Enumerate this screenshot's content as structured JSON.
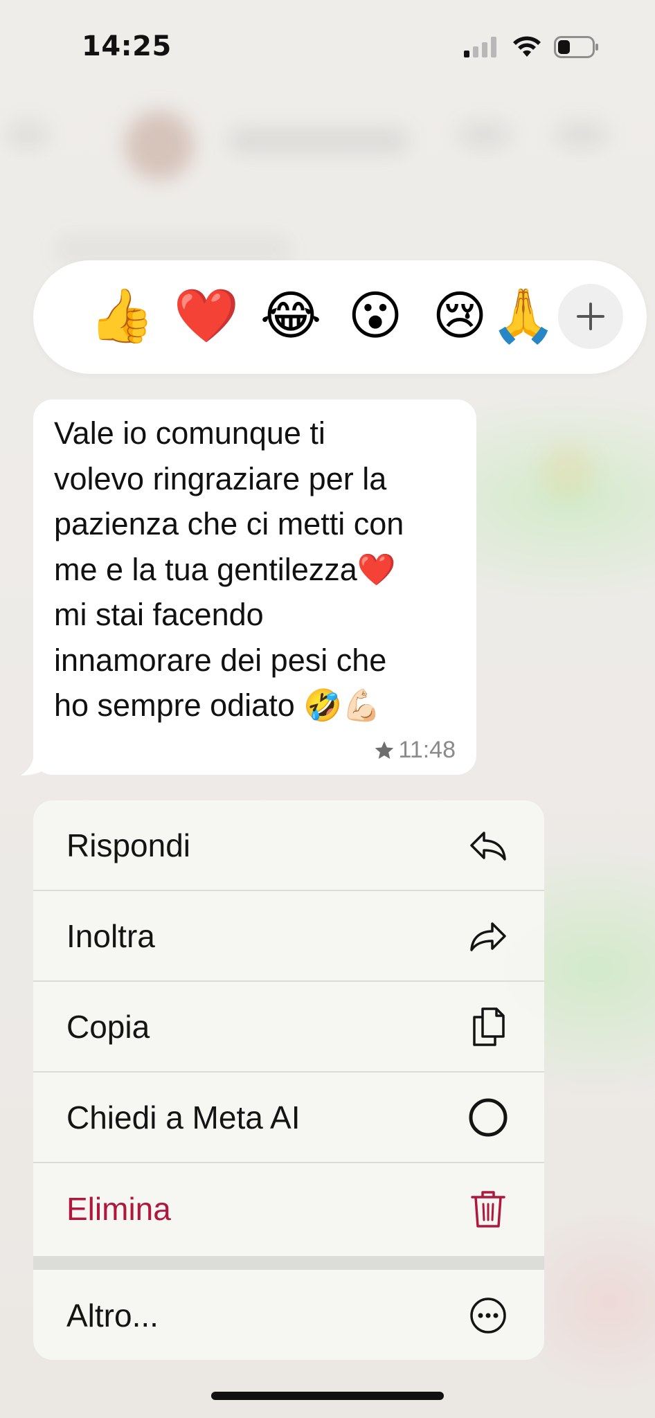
{
  "status_bar": {
    "time": "14:25"
  },
  "reactions": [
    {
      "emoji": "👍",
      "name": "thumbs-up"
    },
    {
      "emoji": "❤️",
      "name": "red-heart"
    },
    {
      "emoji": "😂",
      "name": "tears-of-joy"
    },
    {
      "emoji": "😮",
      "name": "open-mouth"
    },
    {
      "emoji": "😢",
      "name": "crying-face"
    },
    {
      "emoji": "🙏",
      "name": "folded-hands"
    }
  ],
  "reaction_more_icon": "plus-icon",
  "message": {
    "text": "Vale io comunque ti\nvolevo ringraziare per la\npazienza che ci metti con\nme e la tua gentilezza❤️\nmi stai facendo\ninnamorare dei pesi che\nho sempre odiato 🤣💪🏻",
    "starred": true,
    "time": "11:48"
  },
  "menu": {
    "items": [
      {
        "label": "Rispondi",
        "icon": "reply-icon"
      },
      {
        "label": "Inoltra",
        "icon": "forward-icon"
      },
      {
        "label": "Copia",
        "icon": "copy-icon"
      },
      {
        "label": "Chiedi a Meta AI",
        "icon": "meta-ai-icon"
      },
      {
        "label": "Elimina",
        "icon": "trash-icon",
        "destructive": true
      }
    ],
    "more": {
      "label": "Altro...",
      "icon": "ellipsis-circle-icon"
    }
  },
  "colors": {
    "destructive": "#b0173c",
    "bubble": "#ffffff",
    "menu_background": "#f7f6f3"
  }
}
